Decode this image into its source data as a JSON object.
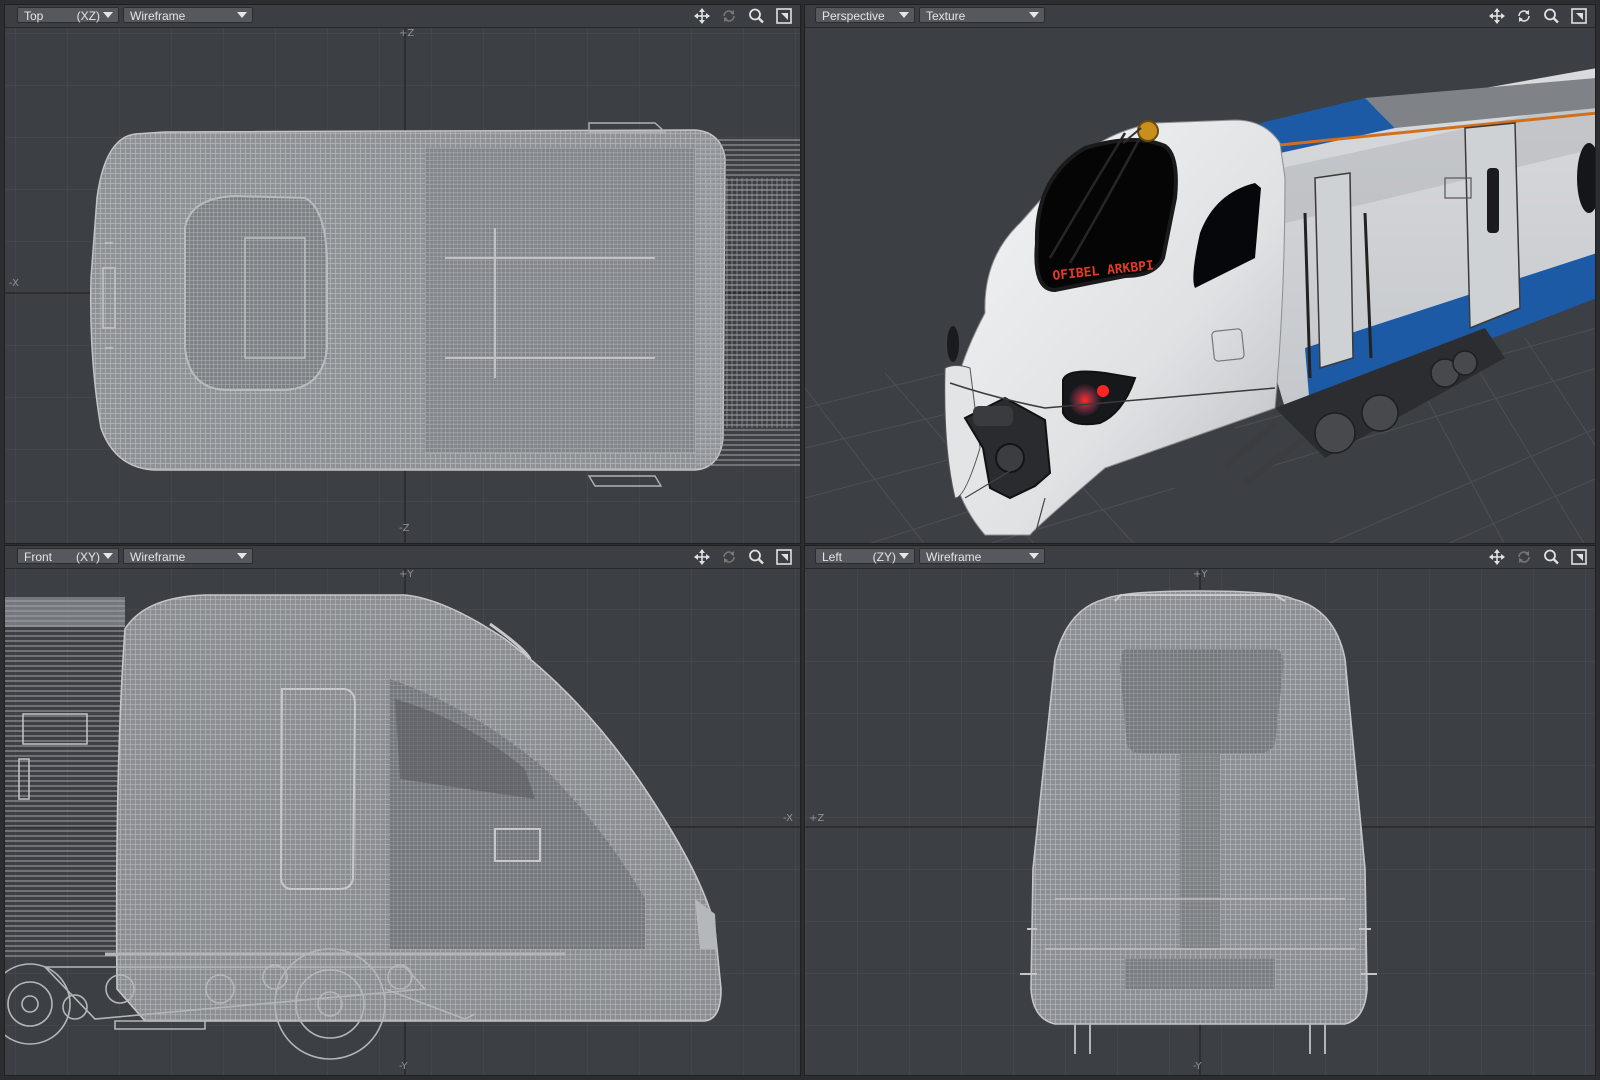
{
  "viewports": {
    "top": {
      "view": "Top",
      "axes": "(XZ)",
      "mode": "Wireframe",
      "axis_labels": {
        "top": "+Z",
        "bottom": "-Z",
        "left": "-X"
      }
    },
    "perspective": {
      "view": "Perspective",
      "mode": "Texture",
      "display_text": "OFIBEL  ARKBPI"
    },
    "front": {
      "view": "Front",
      "axes": "(XY)",
      "mode": "Wireframe",
      "axis_labels": {
        "top": "+Y",
        "bottom": "-Y",
        "right": "-X"
      }
    },
    "left": {
      "view": "Left",
      "axes": "(ZY)",
      "mode": "Wireframe",
      "axis_labels": {
        "top": "+Y",
        "bottom": "-Y",
        "left": "+Z"
      }
    }
  },
  "tools": [
    "move-icon",
    "rotate-icon",
    "zoom-icon",
    "maximize-icon"
  ],
  "colors": {
    "viewport_bg": "#3c3f43",
    "grid": "#4a4d52",
    "wire": "#a3a6aa",
    "train_body": "#e9eaec",
    "train_blue": "#1c5aa6",
    "train_orange": "#d0701e"
  }
}
